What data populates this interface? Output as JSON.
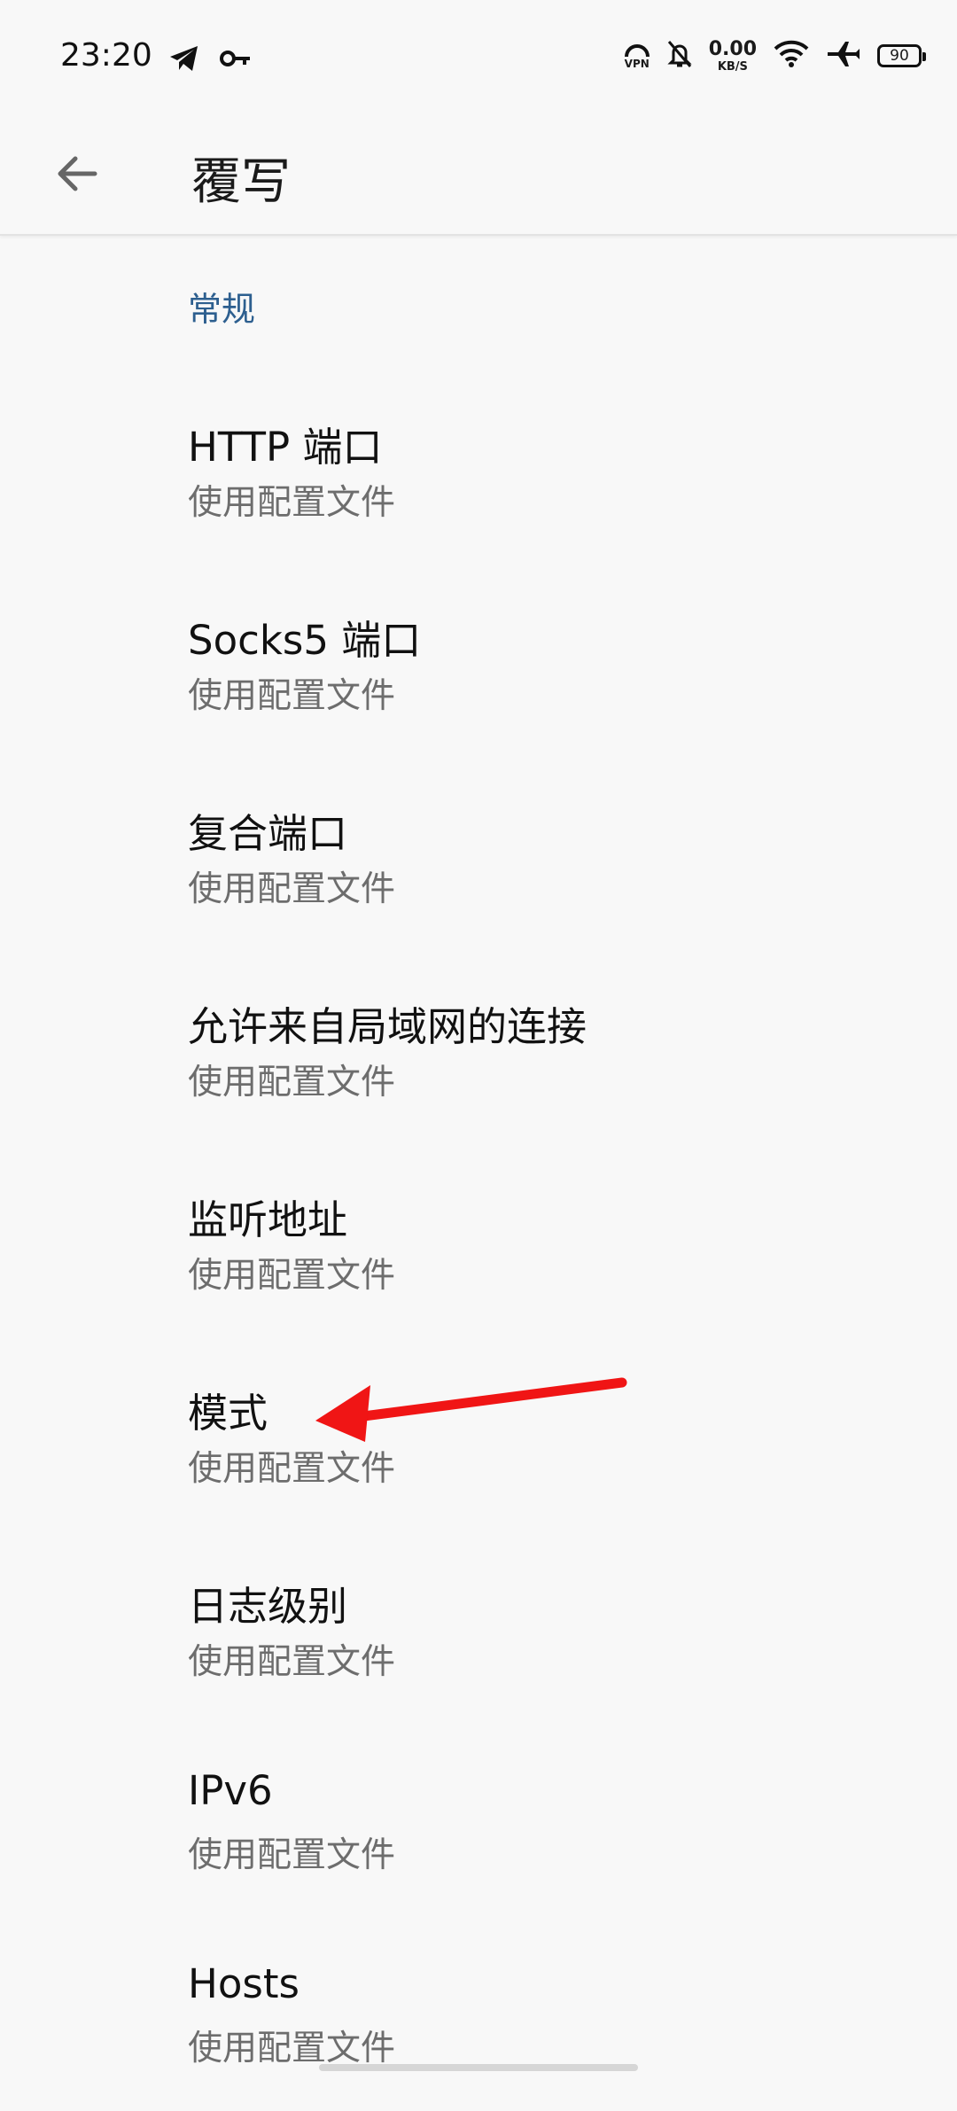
{
  "status_bar": {
    "time": "23:20",
    "left_icons": [
      "telegram-icon",
      "key-icon"
    ],
    "vpn_label": "VPN",
    "speed_value": "0.00",
    "speed_unit": "KB/S",
    "battery": "90"
  },
  "app_bar": {
    "title": "覆写",
    "back_icon": "arrow-left-icon"
  },
  "section": {
    "title": "常规"
  },
  "settings": [
    {
      "title": "HTTP 端口",
      "summary": "使用配置文件"
    },
    {
      "title": "Socks5 端口",
      "summary": "使用配置文件"
    },
    {
      "title": "复合端口",
      "summary": "使用配置文件"
    },
    {
      "title": "允许来自局域网的连接",
      "summary": "使用配置文件"
    },
    {
      "title": "监听地址",
      "summary": "使用配置文件"
    },
    {
      "title": "模式",
      "summary": "使用配置文件"
    },
    {
      "title": "日志级别",
      "summary": "使用配置文件"
    },
    {
      "title": "IPv6",
      "summary": "使用配置文件"
    },
    {
      "title": "Hosts",
      "summary": "使用配置文件"
    }
  ],
  "colors": {
    "background": "#f8f8f8",
    "section_header": "#2d5f8f",
    "summary_text": "#6d6d6d",
    "annotation_arrow": "#f01515"
  }
}
